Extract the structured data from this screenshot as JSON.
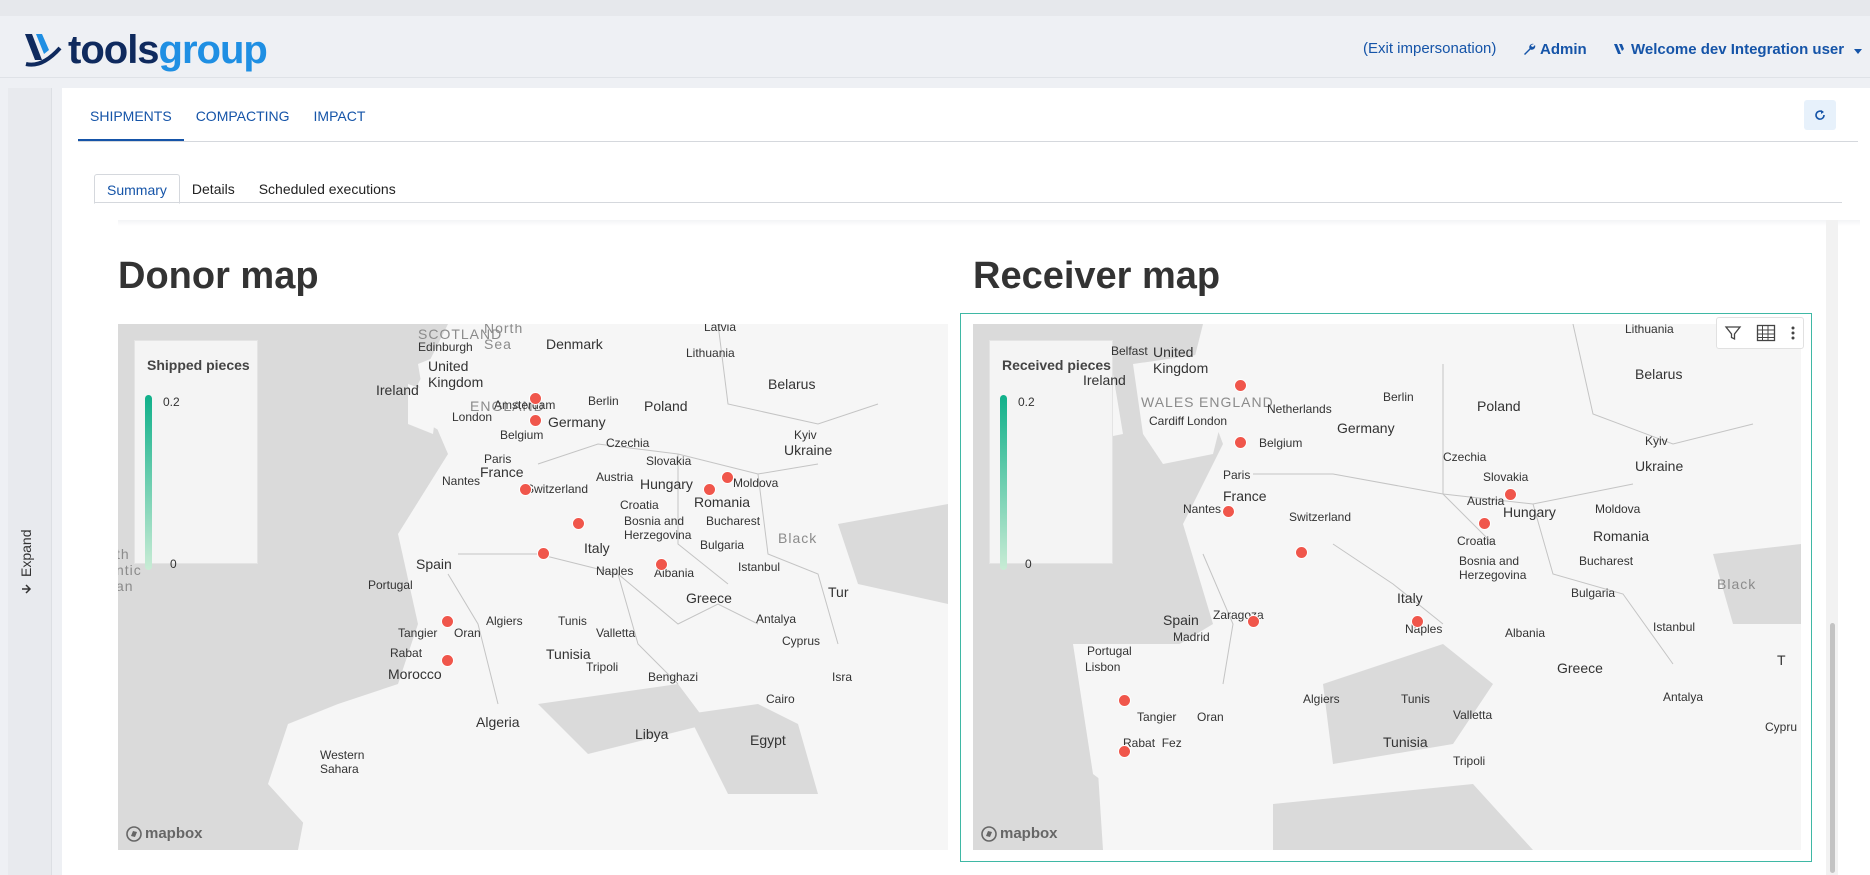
{
  "header": {
    "logo": {
      "part1": "tools",
      "part2": "group"
    },
    "exit_impersonation": "(Exit impersonation)",
    "admin": "Admin",
    "welcome": "Welcome dev Integration user"
  },
  "sidebar": {
    "expand_label": "Expand"
  },
  "main_tabs": [
    {
      "label": "SHIPMENTS",
      "active": true
    },
    {
      "label": "COMPACTING",
      "active": false
    },
    {
      "label": "IMPACT",
      "active": false
    }
  ],
  "sub_tabs": [
    {
      "label": "Summary",
      "active": true
    },
    {
      "label": "Details",
      "active": false
    },
    {
      "label": "Scheduled executions",
      "active": false
    }
  ],
  "donor": {
    "title": "Donor map",
    "legend": {
      "title": "Shipped pieces",
      "max": "0.2",
      "min": "0"
    },
    "labels": {
      "north_sea": "North\nSea",
      "denmark": "Denmark",
      "latvia": "Latvia",
      "lithuania": "Lithuania",
      "belarus": "Belarus",
      "scotland": "SCOTLAND",
      "edinburgh": "Edinburgh",
      "united_kingdom": "United\nKingdom",
      "ireland": "Ireland",
      "england": "ENGLAND",
      "london": "London",
      "amsterdam": "Amsterdam",
      "berlin": "Berlin",
      "poland": "Poland",
      "germany": "Germany",
      "belgium": "Belgium",
      "kyiv": "Kyiv",
      "ukraine": "Ukraine",
      "czechia": "Czechia",
      "paris": "Paris",
      "france": "France",
      "slovakia": "Slovakia",
      "nantes": "Nantes",
      "austria": "Austria",
      "hungary": "Hungary",
      "moldova": "Moldova",
      "switzerland": "Switzerland",
      "romania": "Romania",
      "croatia": "Croatia",
      "bosnia": "Bosnia and\nHerzegovina",
      "bucharest": "Bucharest",
      "black": "Black",
      "spain": "Spain",
      "italy": "Italy",
      "bulgaria": "Bulgaria",
      "portugal": "Portugal",
      "naples": "Naples",
      "albania": "Albania",
      "istanbul": "Istanbul",
      "greece": "Greece",
      "tur": "Tur",
      "algiers": "Algiers",
      "tunis": "Tunis",
      "tangier": "Tangier",
      "oran": "Oran",
      "valletta": "Valletta",
      "antalya": "Antalya",
      "tunisia": "Tunisia",
      "cyprus": "Cyprus",
      "rabat": "Rabat",
      "tripoli": "Tripoli",
      "morocco": "Morocco",
      "benghazi": "Benghazi",
      "isra": "Isra",
      "cairo": "Cairo",
      "algeria": "Algeria",
      "libya": "Libya",
      "egypt": "Egypt",
      "western_sahara": "Western\nSahara",
      "atlantic": "th\nntic\nan"
    },
    "points": [
      [
        0.504,
        0.142
      ],
      [
        0.504,
        0.185
      ],
      [
        0.491,
        0.315
      ],
      [
        0.556,
        0.38
      ],
      [
        0.513,
        0.438
      ],
      [
        0.713,
        0.315
      ],
      [
        0.735,
        0.292
      ],
      [
        0.655,
        0.459
      ],
      [
        0.397,
        0.566
      ],
      [
        0.397,
        0.64
      ]
    ]
  },
  "receiver": {
    "title": "Receiver map",
    "legend": {
      "title": "Received pieces",
      "max": "0.2",
      "min": "0"
    },
    "labels": {
      "lithuania": "Lithuania",
      "belfast": "Belfast",
      "united_kingdom": "United\nKingdom",
      "ireland": "Ireland",
      "belarus": "Belarus",
      "wales": "WALES",
      "england": "ENGLAND",
      "netherlands": "Netherlands",
      "berlin": "Berlin",
      "poland": "Poland",
      "cardiff": "Cardiff",
      "london": "London",
      "germany": "Germany",
      "belgium": "Belgium",
      "kyiv": "Kyiv",
      "czechia": "Czechia",
      "ukraine": "Ukraine",
      "paris": "Paris",
      "slovakia": "Slovakia",
      "france": "France",
      "austria": "Austria",
      "nantes": "Nantes",
      "moldova": "Moldova",
      "switzerland": "Switzerland",
      "hungary": "Hungary",
      "romania": "Romania",
      "croatia": "Croatia",
      "bosnia": "Bosnia and\nHerzegovina",
      "bucharest": "Bucharest",
      "black": "Black",
      "bulgaria": "Bulgaria",
      "spain": "Spain",
      "italy": "Italy",
      "zaragoza": "Zaragoza",
      "madrid": "Madrid",
      "portugal": "Portugal",
      "lisbon": "Lisbon",
      "naples": "Naples",
      "albania": "Albania",
      "istanbul": "Istanbul",
      "greece": "Greece",
      "t": "T",
      "algiers": "Algiers",
      "tunis": "Tunis",
      "tangier": "Tangier",
      "oran": "Oran",
      "valletta": "Valletta",
      "antalya": "Antalya",
      "tunisia": "Tunisia",
      "cypru": "Cypru",
      "rabat_fez": "Rabat  Fez",
      "tripoli": "Tripoli"
    },
    "points": [
      [
        0.324,
        0.117
      ],
      [
        0.324,
        0.226
      ],
      [
        0.309,
        0.357
      ],
      [
        0.397,
        0.435
      ],
      [
        0.339,
        0.566
      ],
      [
        0.538,
        0.566
      ],
      [
        0.65,
        0.325
      ],
      [
        0.618,
        0.38
      ],
      [
        0.183,
        0.717
      ],
      [
        0.183,
        0.813
      ]
    ]
  },
  "icons": [
    "wrench-icon",
    "user-icon",
    "caret-down-icon",
    "refresh-icon",
    "arrow-right-icon",
    "filter-icon",
    "table-icon",
    "more-vertical-icon",
    "mapbox-logo-icon"
  ]
}
